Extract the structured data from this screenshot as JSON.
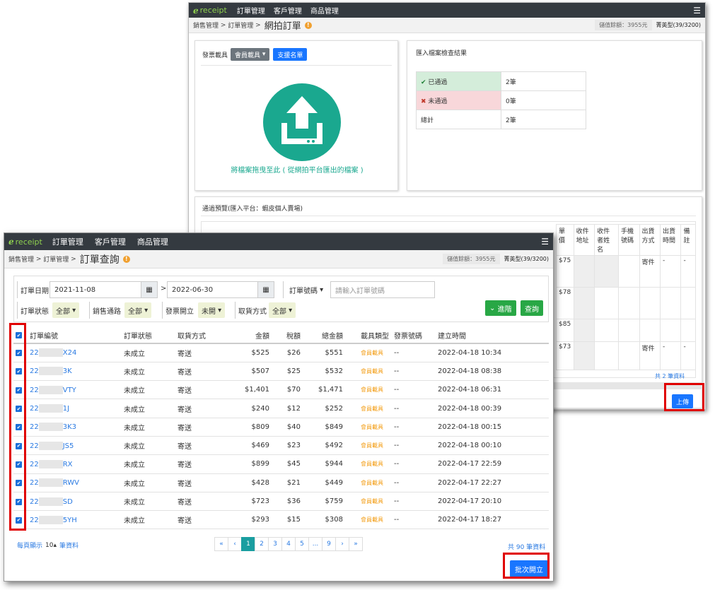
{
  "back": {
    "logo_text": "receipt",
    "nav": [
      "訂單管理",
      "客戶管理",
      "商品管理"
    ],
    "breadcrumb": [
      "銷售管理",
      "訂單管理"
    ],
    "title": "網拍訂單",
    "balance": "儲值餘額：3955元",
    "plan": "菁英型(39/3200)",
    "upload": {
      "carrier_label": "發票載具",
      "carrier_value": "會員載具",
      "support_list": "支援名單",
      "drop_text": "將檔案拖曳至此 ( 從網拍平台匯出的檔案 )"
    },
    "check": {
      "title": "匯入檔案檢查結果",
      "rows": [
        {
          "label": "已通過",
          "value": "2筆"
        },
        {
          "label": "未通過",
          "value": "0筆"
        },
        {
          "label": "總計",
          "value": "2筆"
        }
      ]
    },
    "preview": {
      "title": "通過預覽(匯入平台：蝦皮個人賣場)",
      "headers": [
        "單價",
        "收件地址",
        "收件者姓名",
        "手機號碼",
        "出貨方式",
        "出貨時間",
        "備註"
      ],
      "prices": [
        "$75",
        "$78",
        "$85",
        "$73"
      ],
      "ship": [
        "寄件",
        "寄件"
      ],
      "dash": "-",
      "total": "共 2 筆資料",
      "upload_btn": "上傳"
    }
  },
  "front": {
    "logo_text": "receipt",
    "nav": [
      "訂單管理",
      "客戶管理",
      "商品管理"
    ],
    "breadcrumb": [
      "銷售管理",
      "訂單管理"
    ],
    "title": "訂單查詢",
    "balance": "儲值餘額：3955元",
    "plan": "菁英型(39/3200)",
    "filters": {
      "date_label": "訂單日期",
      "date_from": "2021-11-08",
      "date_to": "2022-06-30",
      "date_sep": ">",
      "order_no_label": "訂單號碼",
      "order_no_placeholder": "請輸入訂單號碼",
      "status_label": "訂單狀態",
      "status_value": "全部",
      "channel_label": "銷售通路",
      "channel_value": "全部",
      "invoice_label": "發票開立",
      "invoice_value": "未開",
      "pickup_label": "取貨方式",
      "pickup_value": "全部",
      "advanced": "進階",
      "search": "查詢"
    },
    "table": {
      "headers": [
        "訂單編號",
        "訂單狀態",
        "取貨方式",
        "金額",
        "稅額",
        "總金額",
        "載具類型",
        "發票號碼",
        "建立時間"
      ],
      "rows": [
        {
          "id_prefix": "22",
          "id_suffix": "X24",
          "status": "未成立",
          "pickup": "寄送",
          "amount": "$525",
          "tax": "$26",
          "total": "$551",
          "carrier": "會員載具",
          "invoice": "--",
          "created": "2022-04-18 10:34"
        },
        {
          "id_prefix": "22",
          "id_suffix": "3K",
          "status": "未成立",
          "pickup": "寄送",
          "amount": "$507",
          "tax": "$25",
          "total": "$532",
          "carrier": "會員載具",
          "invoice": "--",
          "created": "2022-04-18 08:38"
        },
        {
          "id_prefix": "22",
          "id_suffix": "VTY",
          "status": "未成立",
          "pickup": "寄送",
          "amount": "$1,401",
          "tax": "$70",
          "total": "$1,471",
          "carrier": "會員載具",
          "invoice": "--",
          "created": "2022-04-18 06:31"
        },
        {
          "id_prefix": "22",
          "id_suffix": "1J",
          "status": "未成立",
          "pickup": "寄送",
          "amount": "$240",
          "tax": "$12",
          "total": "$252",
          "carrier": "會員載具",
          "invoice": "--",
          "created": "2022-04-18 00:39"
        },
        {
          "id_prefix": "22",
          "id_suffix": "3K3",
          "status": "未成立",
          "pickup": "寄送",
          "amount": "$809",
          "tax": "$40",
          "total": "$849",
          "carrier": "會員載具",
          "invoice": "--",
          "created": "2022-04-18 00:15"
        },
        {
          "id_prefix": "22",
          "id_suffix": "JS5",
          "status": "未成立",
          "pickup": "寄送",
          "amount": "$469",
          "tax": "$23",
          "total": "$492",
          "carrier": "會員載具",
          "invoice": "--",
          "created": "2022-04-18 00:10"
        },
        {
          "id_prefix": "22",
          "id_suffix": "RX",
          "status": "未成立",
          "pickup": "寄送",
          "amount": "$899",
          "tax": "$45",
          "total": "$944",
          "carrier": "會員載具",
          "invoice": "--",
          "created": "2022-04-17 22:59"
        },
        {
          "id_prefix": "22",
          "id_suffix": "RWV",
          "status": "未成立",
          "pickup": "寄送",
          "amount": "$428",
          "tax": "$21",
          "total": "$449",
          "carrier": "會員載具",
          "invoice": "--",
          "created": "2022-04-17 22:27"
        },
        {
          "id_prefix": "22",
          "id_suffix": "SD",
          "status": "未成立",
          "pickup": "寄送",
          "amount": "$723",
          "tax": "$36",
          "total": "$759",
          "carrier": "會員載具",
          "invoice": "--",
          "created": "2022-04-17 20:10"
        },
        {
          "id_prefix": "22",
          "id_suffix": "5YH",
          "status": "未成立",
          "pickup": "寄送",
          "amount": "$293",
          "tax": "$15",
          "total": "$308",
          "carrier": "會員載具",
          "invoice": "--",
          "created": "2022-04-17 18:27"
        }
      ]
    },
    "footer": {
      "per_page_label": "每頁顯示",
      "per_page_value": "10",
      "per_page_unit": "筆資料",
      "pages": [
        "«",
        "‹",
        "1",
        "2",
        "3",
        "4",
        "5",
        "...",
        "9",
        "›",
        "»"
      ],
      "total": "共 90 筆資料",
      "batch_btn": "批次開立"
    }
  },
  "colors": {
    "accent": "#1aa88f",
    "primary": "#1976ff",
    "highlight": "#e00000"
  }
}
